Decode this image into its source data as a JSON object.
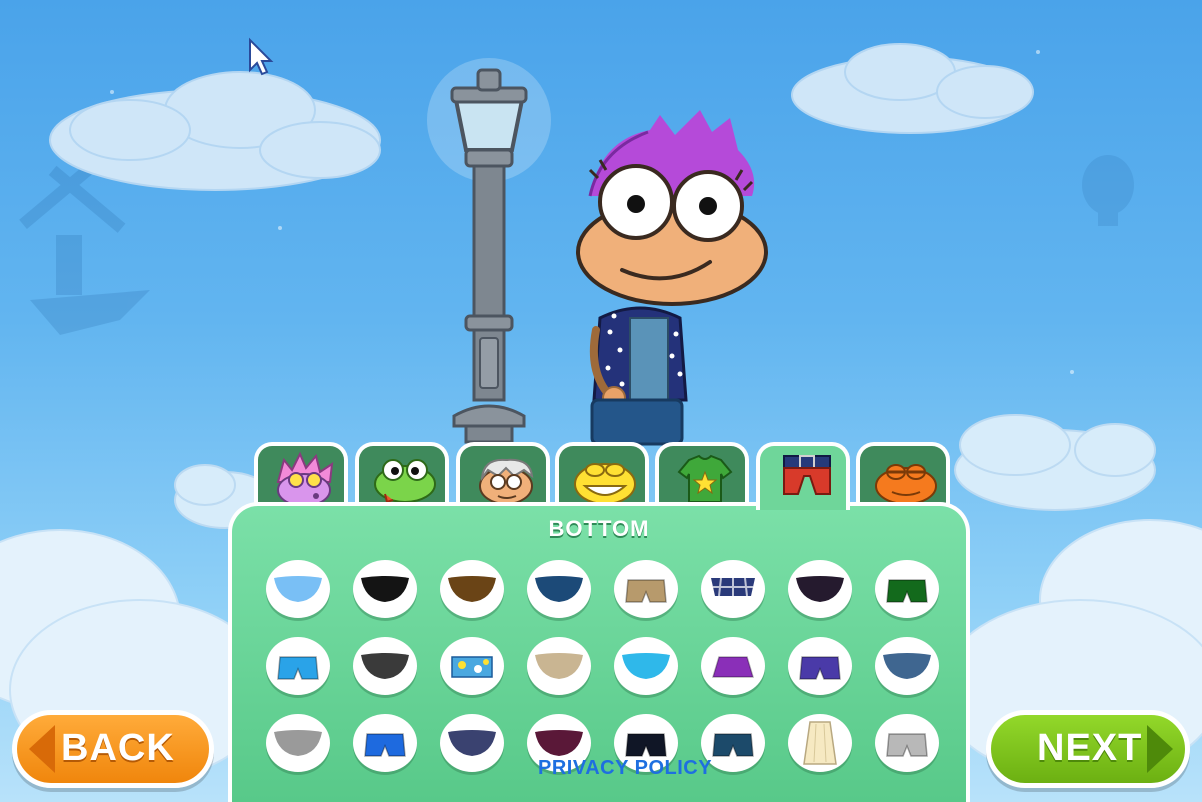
{
  "panel": {
    "title": "BOTTOM"
  },
  "tabs": [
    {
      "name": "hair-tab",
      "icon": "pink-spiky-hair-face-icon",
      "active": false
    },
    {
      "name": "eyes-tab",
      "icon": "frog-tongue-face-icon",
      "active": false
    },
    {
      "name": "head-tab",
      "icon": "old-man-face-icon",
      "active": false
    },
    {
      "name": "mouth-tab",
      "icon": "yellow-grin-face-icon",
      "active": false
    },
    {
      "name": "top-tab",
      "icon": "green-star-shirt-icon",
      "active": false
    },
    {
      "name": "bottom-tab",
      "icon": "red-pants-belt-icon",
      "active": true
    },
    {
      "name": "color-tab",
      "icon": "orange-face-icon",
      "active": false
    }
  ],
  "items": [
    {
      "name": "light-blue-bottom",
      "color": "#79bff5",
      "style": "bowl"
    },
    {
      "name": "black-bottom",
      "color": "#141414",
      "style": "bowl"
    },
    {
      "name": "brown-bottom",
      "color": "#6a4416",
      "style": "bowl"
    },
    {
      "name": "navy-bottom",
      "color": "#1c4a78",
      "style": "bowl"
    },
    {
      "name": "khaki-cargo-shorts",
      "color": "#b79a6c",
      "style": "shorts"
    },
    {
      "name": "plaid-bottom",
      "color": "#2a3a7a",
      "style": "plaid"
    },
    {
      "name": "dark-plum-bottom",
      "color": "#251a2e",
      "style": "bowl"
    },
    {
      "name": "green-shorts",
      "color": "#136a1c",
      "style": "shorts"
    },
    {
      "name": "cyan-shorts",
      "color": "#2aa3e8",
      "style": "shorts"
    },
    {
      "name": "charcoal-bottom",
      "color": "#3a3a3a",
      "style": "bowl"
    },
    {
      "name": "floral-shorts",
      "color": "#4aa8e0",
      "style": "pattern"
    },
    {
      "name": "tan-bottom",
      "color": "#c9b592",
      "style": "bowl"
    },
    {
      "name": "aqua-bottom",
      "color": "#2fb8ea",
      "style": "bowl"
    },
    {
      "name": "purple-skirt",
      "color": "#8a2fb8",
      "style": "skirt"
    },
    {
      "name": "violet-shorts",
      "color": "#4a3aa8",
      "style": "shorts"
    },
    {
      "name": "slate-blue-bottom",
      "color": "#3f6690",
      "style": "bowl"
    },
    {
      "name": "gray-bottom",
      "color": "#9a9a9a",
      "style": "bowl"
    },
    {
      "name": "royal-blue-shorts",
      "color": "#1e6adf",
      "style": "shorts"
    },
    {
      "name": "indigo-bottom",
      "color": "#3a4270",
      "style": "bowl"
    },
    {
      "name": "maroon-bottom",
      "color": "#5a1838",
      "style": "bowl"
    },
    {
      "name": "black-shorts",
      "color": "#101626",
      "style": "shorts"
    },
    {
      "name": "teal-shorts",
      "color": "#1c4a6a",
      "style": "shorts"
    },
    {
      "name": "cream-skirt",
      "color": "#f6e9c2",
      "style": "long-skirt"
    },
    {
      "name": "silver-shorts",
      "color": "#b8b8b8",
      "style": "shorts"
    }
  ],
  "footer": {
    "privacy_label": "PRIVACY POLICY"
  },
  "buttons": {
    "back_label": "BACK",
    "next_label": "NEXT"
  },
  "colors": {
    "back": "#f7941d",
    "next": "#7cc11a",
    "panel": "#6fd69a",
    "tab_inactive": "#3f8a5c"
  }
}
